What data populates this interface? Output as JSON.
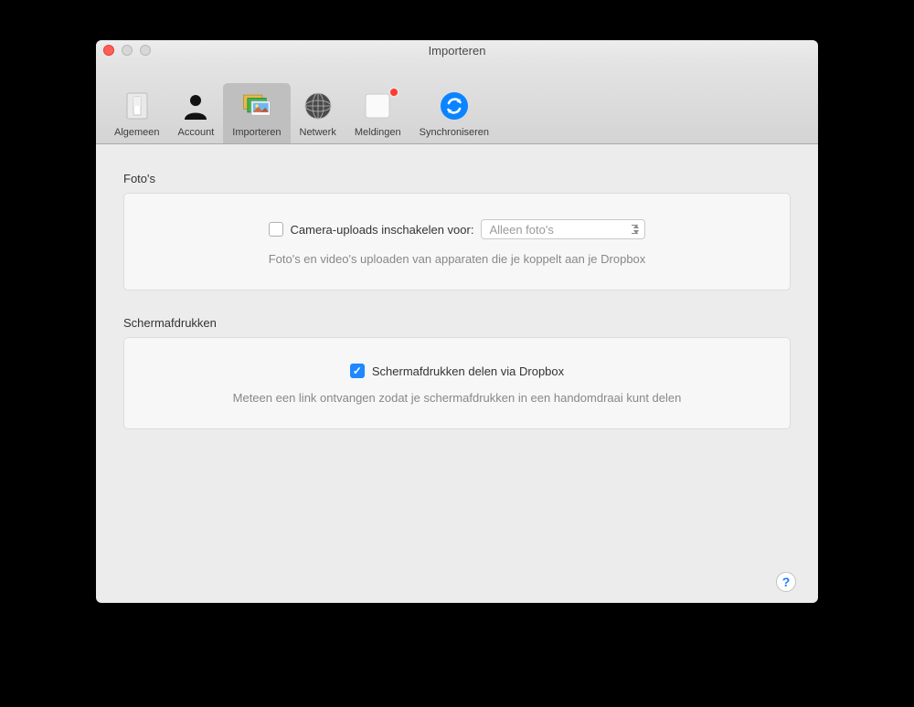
{
  "title": "Importeren",
  "tabs": [
    {
      "id": "general",
      "label": "Algemeen"
    },
    {
      "id": "account",
      "label": "Account"
    },
    {
      "id": "import",
      "label": "Importeren",
      "selected": true
    },
    {
      "id": "network",
      "label": "Netwerk"
    },
    {
      "id": "notifications",
      "label": "Meldingen",
      "badge": true
    },
    {
      "id": "sync",
      "label": "Synchroniseren"
    }
  ],
  "sections": {
    "photos": {
      "title": "Foto's",
      "checkbox_label": "Camera-uploads inschakelen voor:",
      "checkbox_checked": false,
      "select_value": "Alleen foto's",
      "hint": "Foto's en video's uploaden van apparaten die je koppelt aan je Dropbox"
    },
    "screenshots": {
      "title": "Schermafdrukken",
      "checkbox_label": "Schermafdrukken delen via Dropbox",
      "checkbox_checked": true,
      "hint": "Meteen een link ontvangen zodat je schermafdrukken in een handomdraai kunt delen"
    }
  },
  "help_label": "?"
}
